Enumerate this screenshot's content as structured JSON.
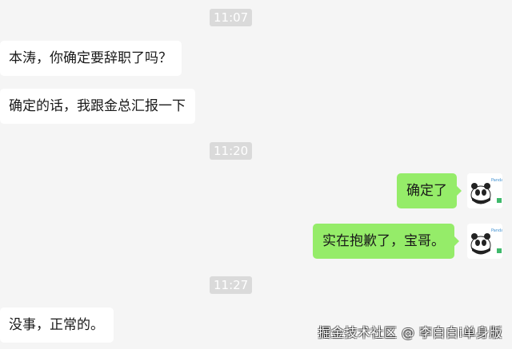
{
  "timestamps": [
    "11:07",
    "11:20",
    "11:27"
  ],
  "messages": [
    {
      "text": "本涛，你确定要辞职了吗？"
    },
    {
      "text": "确定的话，我跟金总汇报一下"
    },
    {
      "text": "确定了"
    },
    {
      "text": "实在抱歉了，宝哥。"
    },
    {
      "text": "没事，正常的。"
    }
  ],
  "avatar": {
    "icon": "panda-avatar-icon",
    "small_text": "Panda"
  },
  "watermark": "掘金技术社区 @ 李白白i单身版",
  "colors": {
    "background": "#f5f5f5",
    "incoming_bubble": "#ffffff",
    "outgoing_bubble": "#95ec69",
    "timestamp_bg": "#dadada"
  }
}
